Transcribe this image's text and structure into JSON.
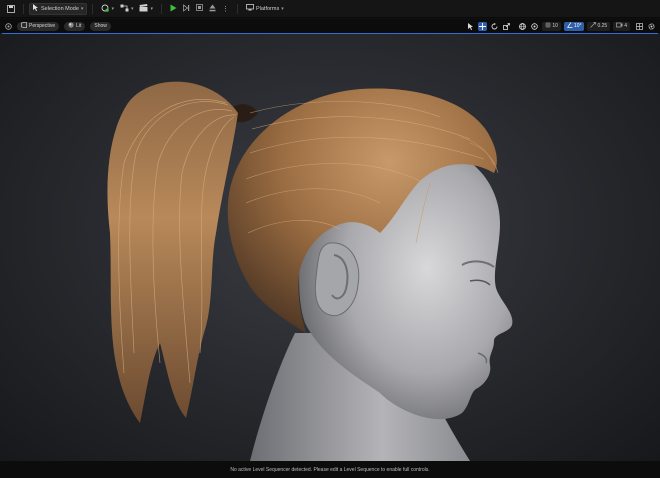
{
  "toolbar": {
    "selection_mode": "Selection Mode",
    "platforms": "Platforms"
  },
  "viewport_toolbar": {
    "perspective": "Perspective",
    "lit": "Lit",
    "show": "Show",
    "field_of_view": "10°",
    "grid_snap": "10",
    "camera_speed": "0.25",
    "screen_percentage": "4"
  },
  "status": {
    "message": "No active Level Sequencer detected. Please edit a Level Sequence to enable full controls."
  },
  "colors": {
    "accent": "#2f5fa8",
    "play": "#3fbf3f",
    "viewport_border": "#2f6fd6"
  }
}
